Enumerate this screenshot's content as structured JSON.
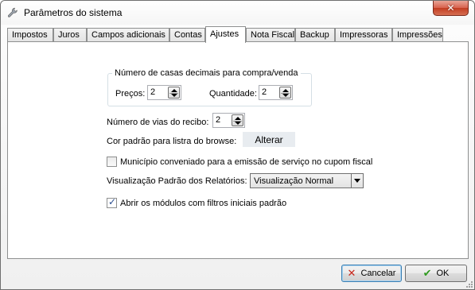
{
  "window": {
    "title": "Parâmetros do sistema",
    "close_glyph": "✕"
  },
  "tabs": [
    {
      "label": "Impostos"
    },
    {
      "label": "Juros"
    },
    {
      "label": "Campos adicionais"
    },
    {
      "label": "Contas"
    },
    {
      "label": "Ajustes",
      "active": true
    },
    {
      "label": "Nota Fiscal"
    },
    {
      "label": "Backup"
    },
    {
      "label": "Impressoras"
    },
    {
      "label": "Impressões"
    }
  ],
  "ajustes": {
    "decimals_group_title": "Número de casas decimais para compra/venda",
    "precos_label": "Preços:",
    "precos_value": "2",
    "quantidade_label": "Quantidade:",
    "quantidade_value": "2",
    "vias_label": "Número de vias do recibo:",
    "vias_value": "2",
    "cor_label": "Cor padrão para listra do browse:",
    "alterar_label": "Alterar",
    "municipio_label": "Município conveniado para a emissão de serviço no cupom fiscal",
    "municipio_checked": false,
    "visualizacao_label": "Visualização Padrão dos Relatórios:",
    "visualizacao_value": "Visualização Normal",
    "abrir_label": "Abrir os módulos com filtros iniciais padrão",
    "abrir_checked": true
  },
  "buttons": {
    "cancel_label": "Cancelar",
    "ok_label": "OK"
  },
  "icons": {
    "app": "wrench-icon",
    "cancel": "red-x-icon",
    "ok": "green-check-icon"
  },
  "colors": {
    "alterar_bg": "#e8ecf0",
    "close_btn": "#c23c21"
  }
}
